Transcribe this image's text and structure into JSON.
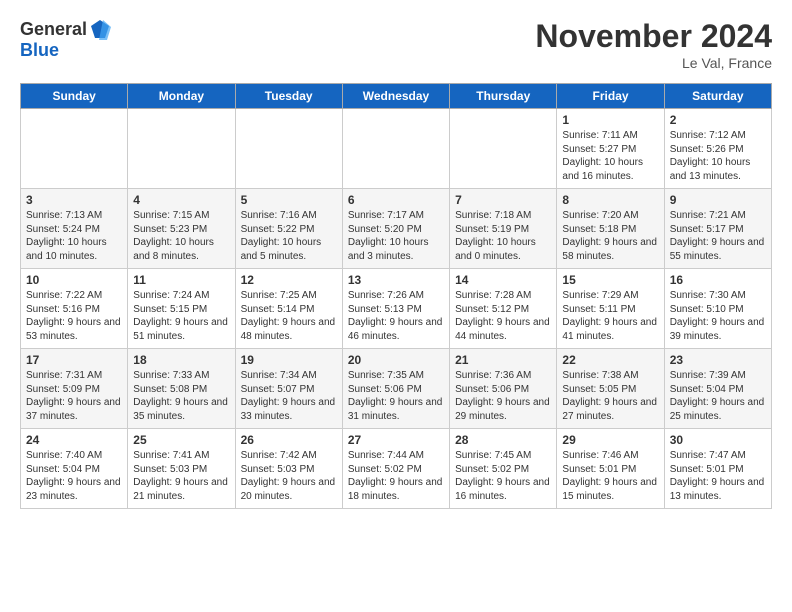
{
  "header": {
    "logo_general": "General",
    "logo_blue": "Blue",
    "title": "November 2024",
    "location": "Le Val, France"
  },
  "days_of_week": [
    "Sunday",
    "Monday",
    "Tuesday",
    "Wednesday",
    "Thursday",
    "Friday",
    "Saturday"
  ],
  "weeks": [
    [
      {
        "day": "",
        "info": ""
      },
      {
        "day": "",
        "info": ""
      },
      {
        "day": "",
        "info": ""
      },
      {
        "day": "",
        "info": ""
      },
      {
        "day": "",
        "info": ""
      },
      {
        "day": "1",
        "info": "Sunrise: 7:11 AM\nSunset: 5:27 PM\nDaylight: 10 hours and 16 minutes."
      },
      {
        "day": "2",
        "info": "Sunrise: 7:12 AM\nSunset: 5:26 PM\nDaylight: 10 hours and 13 minutes."
      }
    ],
    [
      {
        "day": "3",
        "info": "Sunrise: 7:13 AM\nSunset: 5:24 PM\nDaylight: 10 hours and 10 minutes."
      },
      {
        "day": "4",
        "info": "Sunrise: 7:15 AM\nSunset: 5:23 PM\nDaylight: 10 hours and 8 minutes."
      },
      {
        "day": "5",
        "info": "Sunrise: 7:16 AM\nSunset: 5:22 PM\nDaylight: 10 hours and 5 minutes."
      },
      {
        "day": "6",
        "info": "Sunrise: 7:17 AM\nSunset: 5:20 PM\nDaylight: 10 hours and 3 minutes."
      },
      {
        "day": "7",
        "info": "Sunrise: 7:18 AM\nSunset: 5:19 PM\nDaylight: 10 hours and 0 minutes."
      },
      {
        "day": "8",
        "info": "Sunrise: 7:20 AM\nSunset: 5:18 PM\nDaylight: 9 hours and 58 minutes."
      },
      {
        "day": "9",
        "info": "Sunrise: 7:21 AM\nSunset: 5:17 PM\nDaylight: 9 hours and 55 minutes."
      }
    ],
    [
      {
        "day": "10",
        "info": "Sunrise: 7:22 AM\nSunset: 5:16 PM\nDaylight: 9 hours and 53 minutes."
      },
      {
        "day": "11",
        "info": "Sunrise: 7:24 AM\nSunset: 5:15 PM\nDaylight: 9 hours and 51 minutes."
      },
      {
        "day": "12",
        "info": "Sunrise: 7:25 AM\nSunset: 5:14 PM\nDaylight: 9 hours and 48 minutes."
      },
      {
        "day": "13",
        "info": "Sunrise: 7:26 AM\nSunset: 5:13 PM\nDaylight: 9 hours and 46 minutes."
      },
      {
        "day": "14",
        "info": "Sunrise: 7:28 AM\nSunset: 5:12 PM\nDaylight: 9 hours and 44 minutes."
      },
      {
        "day": "15",
        "info": "Sunrise: 7:29 AM\nSunset: 5:11 PM\nDaylight: 9 hours and 41 minutes."
      },
      {
        "day": "16",
        "info": "Sunrise: 7:30 AM\nSunset: 5:10 PM\nDaylight: 9 hours and 39 minutes."
      }
    ],
    [
      {
        "day": "17",
        "info": "Sunrise: 7:31 AM\nSunset: 5:09 PM\nDaylight: 9 hours and 37 minutes."
      },
      {
        "day": "18",
        "info": "Sunrise: 7:33 AM\nSunset: 5:08 PM\nDaylight: 9 hours and 35 minutes."
      },
      {
        "day": "19",
        "info": "Sunrise: 7:34 AM\nSunset: 5:07 PM\nDaylight: 9 hours and 33 minutes."
      },
      {
        "day": "20",
        "info": "Sunrise: 7:35 AM\nSunset: 5:06 PM\nDaylight: 9 hours and 31 minutes."
      },
      {
        "day": "21",
        "info": "Sunrise: 7:36 AM\nSunset: 5:06 PM\nDaylight: 9 hours and 29 minutes."
      },
      {
        "day": "22",
        "info": "Sunrise: 7:38 AM\nSunset: 5:05 PM\nDaylight: 9 hours and 27 minutes."
      },
      {
        "day": "23",
        "info": "Sunrise: 7:39 AM\nSunset: 5:04 PM\nDaylight: 9 hours and 25 minutes."
      }
    ],
    [
      {
        "day": "24",
        "info": "Sunrise: 7:40 AM\nSunset: 5:04 PM\nDaylight: 9 hours and 23 minutes."
      },
      {
        "day": "25",
        "info": "Sunrise: 7:41 AM\nSunset: 5:03 PM\nDaylight: 9 hours and 21 minutes."
      },
      {
        "day": "26",
        "info": "Sunrise: 7:42 AM\nSunset: 5:03 PM\nDaylight: 9 hours and 20 minutes."
      },
      {
        "day": "27",
        "info": "Sunrise: 7:44 AM\nSunset: 5:02 PM\nDaylight: 9 hours and 18 minutes."
      },
      {
        "day": "28",
        "info": "Sunrise: 7:45 AM\nSunset: 5:02 PM\nDaylight: 9 hours and 16 minutes."
      },
      {
        "day": "29",
        "info": "Sunrise: 7:46 AM\nSunset: 5:01 PM\nDaylight: 9 hours and 15 minutes."
      },
      {
        "day": "30",
        "info": "Sunrise: 7:47 AM\nSunset: 5:01 PM\nDaylight: 9 hours and 13 minutes."
      }
    ]
  ]
}
